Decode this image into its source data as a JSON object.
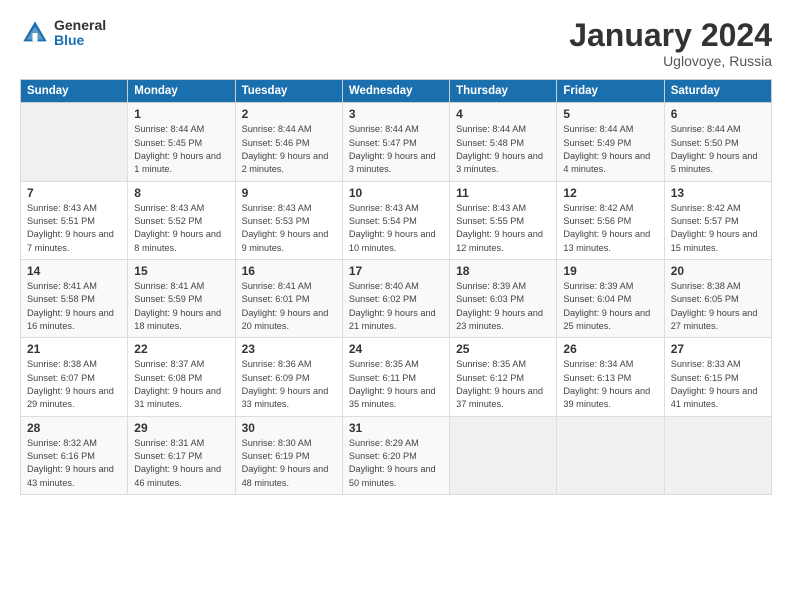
{
  "logo": {
    "general": "General",
    "blue": "Blue"
  },
  "title": "January 2024",
  "location": "Uglovoye, Russia",
  "days_of_week": [
    "Sunday",
    "Monday",
    "Tuesday",
    "Wednesday",
    "Thursday",
    "Friday",
    "Saturday"
  ],
  "weeks": [
    [
      {
        "num": "",
        "sunrise": "",
        "sunset": "",
        "daylight": ""
      },
      {
        "num": "1",
        "sunrise": "Sunrise: 8:44 AM",
        "sunset": "Sunset: 5:45 PM",
        "daylight": "Daylight: 9 hours and 1 minute."
      },
      {
        "num": "2",
        "sunrise": "Sunrise: 8:44 AM",
        "sunset": "Sunset: 5:46 PM",
        "daylight": "Daylight: 9 hours and 2 minutes."
      },
      {
        "num": "3",
        "sunrise": "Sunrise: 8:44 AM",
        "sunset": "Sunset: 5:47 PM",
        "daylight": "Daylight: 9 hours and 3 minutes."
      },
      {
        "num": "4",
        "sunrise": "Sunrise: 8:44 AM",
        "sunset": "Sunset: 5:48 PM",
        "daylight": "Daylight: 9 hours and 3 minutes."
      },
      {
        "num": "5",
        "sunrise": "Sunrise: 8:44 AM",
        "sunset": "Sunset: 5:49 PM",
        "daylight": "Daylight: 9 hours and 4 minutes."
      },
      {
        "num": "6",
        "sunrise": "Sunrise: 8:44 AM",
        "sunset": "Sunset: 5:50 PM",
        "daylight": "Daylight: 9 hours and 5 minutes."
      }
    ],
    [
      {
        "num": "7",
        "sunrise": "Sunrise: 8:43 AM",
        "sunset": "Sunset: 5:51 PM",
        "daylight": "Daylight: 9 hours and 7 minutes."
      },
      {
        "num": "8",
        "sunrise": "Sunrise: 8:43 AM",
        "sunset": "Sunset: 5:52 PM",
        "daylight": "Daylight: 9 hours and 8 minutes."
      },
      {
        "num": "9",
        "sunrise": "Sunrise: 8:43 AM",
        "sunset": "Sunset: 5:53 PM",
        "daylight": "Daylight: 9 hours and 9 minutes."
      },
      {
        "num": "10",
        "sunrise": "Sunrise: 8:43 AM",
        "sunset": "Sunset: 5:54 PM",
        "daylight": "Daylight: 9 hours and 10 minutes."
      },
      {
        "num": "11",
        "sunrise": "Sunrise: 8:43 AM",
        "sunset": "Sunset: 5:55 PM",
        "daylight": "Daylight: 9 hours and 12 minutes."
      },
      {
        "num": "12",
        "sunrise": "Sunrise: 8:42 AM",
        "sunset": "Sunset: 5:56 PM",
        "daylight": "Daylight: 9 hours and 13 minutes."
      },
      {
        "num": "13",
        "sunrise": "Sunrise: 8:42 AM",
        "sunset": "Sunset: 5:57 PM",
        "daylight": "Daylight: 9 hours and 15 minutes."
      }
    ],
    [
      {
        "num": "14",
        "sunrise": "Sunrise: 8:41 AM",
        "sunset": "Sunset: 5:58 PM",
        "daylight": "Daylight: 9 hours and 16 minutes."
      },
      {
        "num": "15",
        "sunrise": "Sunrise: 8:41 AM",
        "sunset": "Sunset: 5:59 PM",
        "daylight": "Daylight: 9 hours and 18 minutes."
      },
      {
        "num": "16",
        "sunrise": "Sunrise: 8:41 AM",
        "sunset": "Sunset: 6:01 PM",
        "daylight": "Daylight: 9 hours and 20 minutes."
      },
      {
        "num": "17",
        "sunrise": "Sunrise: 8:40 AM",
        "sunset": "Sunset: 6:02 PM",
        "daylight": "Daylight: 9 hours and 21 minutes."
      },
      {
        "num": "18",
        "sunrise": "Sunrise: 8:39 AM",
        "sunset": "Sunset: 6:03 PM",
        "daylight": "Daylight: 9 hours and 23 minutes."
      },
      {
        "num": "19",
        "sunrise": "Sunrise: 8:39 AM",
        "sunset": "Sunset: 6:04 PM",
        "daylight": "Daylight: 9 hours and 25 minutes."
      },
      {
        "num": "20",
        "sunrise": "Sunrise: 8:38 AM",
        "sunset": "Sunset: 6:05 PM",
        "daylight": "Daylight: 9 hours and 27 minutes."
      }
    ],
    [
      {
        "num": "21",
        "sunrise": "Sunrise: 8:38 AM",
        "sunset": "Sunset: 6:07 PM",
        "daylight": "Daylight: 9 hours and 29 minutes."
      },
      {
        "num": "22",
        "sunrise": "Sunrise: 8:37 AM",
        "sunset": "Sunset: 6:08 PM",
        "daylight": "Daylight: 9 hours and 31 minutes."
      },
      {
        "num": "23",
        "sunrise": "Sunrise: 8:36 AM",
        "sunset": "Sunset: 6:09 PM",
        "daylight": "Daylight: 9 hours and 33 minutes."
      },
      {
        "num": "24",
        "sunrise": "Sunrise: 8:35 AM",
        "sunset": "Sunset: 6:11 PM",
        "daylight": "Daylight: 9 hours and 35 minutes."
      },
      {
        "num": "25",
        "sunrise": "Sunrise: 8:35 AM",
        "sunset": "Sunset: 6:12 PM",
        "daylight": "Daylight: 9 hours and 37 minutes."
      },
      {
        "num": "26",
        "sunrise": "Sunrise: 8:34 AM",
        "sunset": "Sunset: 6:13 PM",
        "daylight": "Daylight: 9 hours and 39 minutes."
      },
      {
        "num": "27",
        "sunrise": "Sunrise: 8:33 AM",
        "sunset": "Sunset: 6:15 PM",
        "daylight": "Daylight: 9 hours and 41 minutes."
      }
    ],
    [
      {
        "num": "28",
        "sunrise": "Sunrise: 8:32 AM",
        "sunset": "Sunset: 6:16 PM",
        "daylight": "Daylight: 9 hours and 43 minutes."
      },
      {
        "num": "29",
        "sunrise": "Sunrise: 8:31 AM",
        "sunset": "Sunset: 6:17 PM",
        "daylight": "Daylight: 9 hours and 46 minutes."
      },
      {
        "num": "30",
        "sunrise": "Sunrise: 8:30 AM",
        "sunset": "Sunset: 6:19 PM",
        "daylight": "Daylight: 9 hours and 48 minutes."
      },
      {
        "num": "31",
        "sunrise": "Sunrise: 8:29 AM",
        "sunset": "Sunset: 6:20 PM",
        "daylight": "Daylight: 9 hours and 50 minutes."
      },
      {
        "num": "",
        "sunrise": "",
        "sunset": "",
        "daylight": ""
      },
      {
        "num": "",
        "sunrise": "",
        "sunset": "",
        "daylight": ""
      },
      {
        "num": "",
        "sunrise": "",
        "sunset": "",
        "daylight": ""
      }
    ]
  ]
}
